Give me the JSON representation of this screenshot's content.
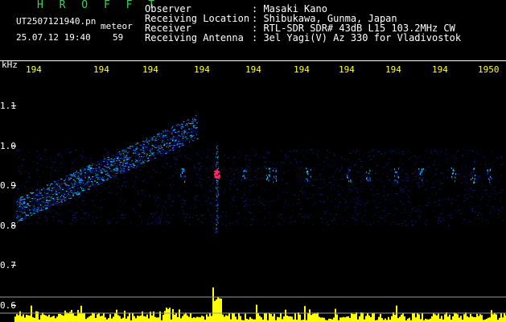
{
  "header": {
    "title": "H R O F F T",
    "filename": "UT2507121940.pn",
    "tag": "meteor",
    "datetime": "25.07.12 19:40",
    "count": "59",
    "observer_label": "Observer",
    "observer_value": ": Masaki Kano",
    "location_label": "Receiving Location",
    "location_value": ": Shibukawa, Gunma, Japan",
    "receiver_label": "Receiver",
    "receiver_value": ": RTL-SDR SDR# 43dB L15 103.2MHz CW",
    "antenna_label": "Receiving Antenna",
    "antenna_value": ": 3el Yagi(V) Az 330 for Vladivostok"
  },
  "axis": {
    "unit": "kHz",
    "time_labels": [
      "194",
      "194",
      "194",
      "194",
      "194",
      "194",
      "194",
      "194",
      "194",
      "1950"
    ],
    "freq_labels": [
      "1.1",
      "1.0",
      "0.9",
      "0.8",
      "0.7",
      "0.6"
    ]
  },
  "colors": {
    "background": "#000000",
    "text": "#ffffff",
    "title": "#39d65c",
    "time_labels": "#ffff33",
    "spectrum_low": "#0a1a8c",
    "spectrum_mid": "#2f7dff",
    "spectrum_high": "#1fd0ff",
    "spectrum_peak": "#ff2a6a",
    "amplitude": "#ffff00"
  }
}
